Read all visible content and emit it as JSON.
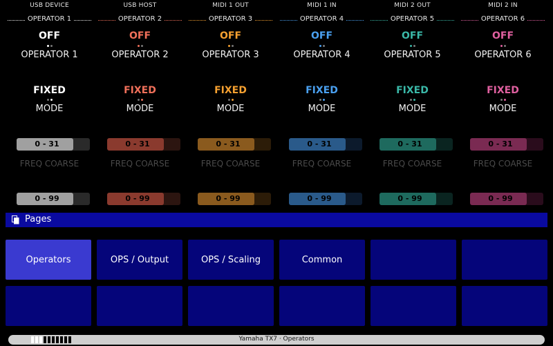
{
  "colors": {
    "op1": "#ffffff",
    "op2": "#f0705a",
    "op3": "#f5a030",
    "op4": "#4aa0f0",
    "op5": "#3ab8a8",
    "op6": "#e060a0"
  },
  "columns": [
    {
      "port": "USB DEVICE",
      "operator": "OPERATOR 1",
      "switch": "OFF",
      "switch_label": "OPERATOR 1",
      "mode": "FIXED",
      "mode_label": "MODE",
      "freq_range": "0 - 31",
      "freq_label": "FREQ COARSE",
      "range2": "0 - 99"
    },
    {
      "port": "USB HOST",
      "operator": "OPERATOR 2",
      "switch": "OFF",
      "switch_label": "OPERATOR 2",
      "mode": "FIXED",
      "mode_label": "MODE",
      "freq_range": "0 - 31",
      "freq_label": "FREQ COARSE",
      "range2": "0 - 99"
    },
    {
      "port": "MIDI 1 OUT",
      "operator": "OPERATOR 3",
      "switch": "OFF",
      "switch_label": "OPERATOR 3",
      "mode": "FIXED",
      "mode_label": "MODE",
      "freq_range": "0 - 31",
      "freq_label": "FREQ COARSE",
      "range2": "0 - 99"
    },
    {
      "port": "MIDI 1 IN",
      "operator": "OPERATOR 4",
      "switch": "OFF",
      "switch_label": "OPERATOR 4",
      "mode": "FIXED",
      "mode_label": "MODE",
      "freq_range": "0 - 31",
      "freq_label": "FREQ COARSE",
      "range2": "0 - 99"
    },
    {
      "port": "MIDI 2 OUT",
      "operator": "OPERATOR 5",
      "switch": "OFF",
      "switch_label": "OPERATOR 5",
      "mode": "FIXED",
      "mode_label": "MODE",
      "freq_range": "0 - 31",
      "freq_label": "FREQ COARSE",
      "range2": "0 - 99"
    },
    {
      "port": "MIDI 2 IN",
      "operator": "OPERATOR 6",
      "switch": "OFF",
      "switch_label": "OPERATOR 6",
      "mode": "FIXED",
      "mode_label": "MODE",
      "freq_range": "0 - 31",
      "freq_label": "FREQ COARSE",
      "range2": "0 - 99"
    }
  ],
  "pages": {
    "title": "Pages",
    "icon": "pages-icon",
    "tiles": [
      {
        "label": "Operators",
        "active": true
      },
      {
        "label": "OPS / Output"
      },
      {
        "label": "OPS / Scaling"
      },
      {
        "label": "Common"
      },
      {
        "label": ""
      },
      {
        "label": ""
      },
      {
        "label": ""
      },
      {
        "label": ""
      },
      {
        "label": ""
      },
      {
        "label": ""
      },
      {
        "label": ""
      },
      {
        "label": ""
      }
    ]
  },
  "status": {
    "title": "Yamaha TX7 · Operators",
    "level_fraction": 0.3
  }
}
